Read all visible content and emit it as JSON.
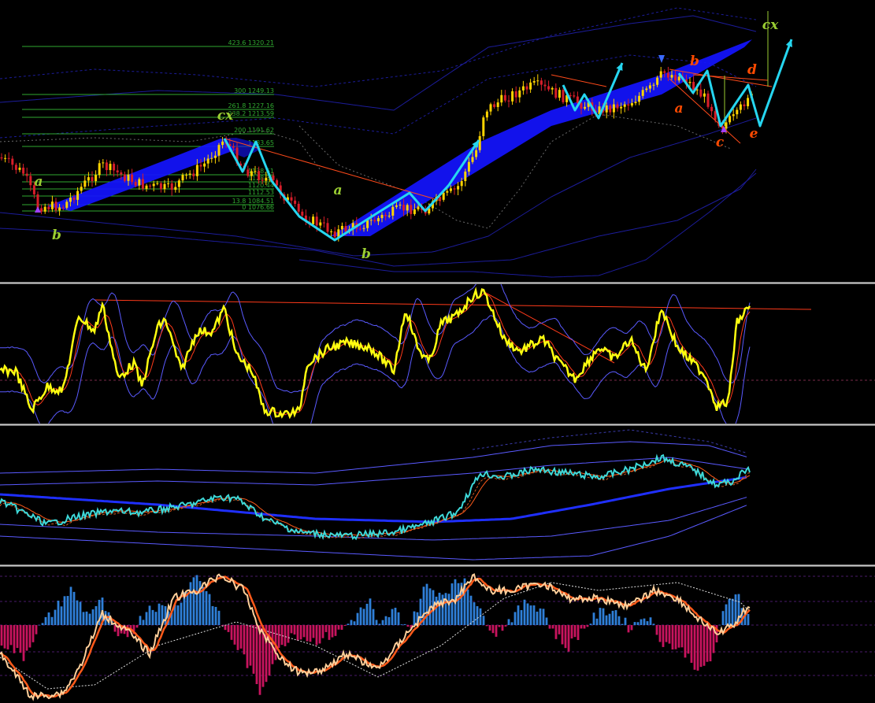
{
  "colors": {
    "background": "#000000",
    "candle": "#ffd400",
    "candle_down": "#d81e2a",
    "channel_fill": "#1414ff",
    "zigzag": "#26d6f0",
    "wave_green": "#9acd32",
    "wave_orange": "#ff4a00",
    "fib": "#2fa82f",
    "trend_red": "#ff4a1a",
    "band_navy": "#1c1c9a",
    "osc_yellow": "#ffff10",
    "osc_band": "#5a5aff",
    "osc_mid": "#ff3a1a",
    "line_cyan": "#3ed8d8",
    "line_blue": "#1f2fff",
    "hist_pos": "#2f7fd8",
    "hist_neg": "#c8145e",
    "peach": "#ffcf9a",
    "orange_line": "#ff5a1a",
    "dotted_white": "#e0e0e0"
  },
  "fib_levels": [
    {
      "label": "423.6 1320.21",
      "price": 1320.21
    },
    {
      "label": "300 1249.13",
      "price": 1249.13
    },
    {
      "label": "261.8 1227.16",
      "price": 1227.16
    },
    {
      "label": "238.2 1213.59",
      "price": 1213.59
    },
    {
      "label": "200 1191.62",
      "price": 1191.62
    },
    {
      "label": "1183.65",
      "price": 1183.65
    },
    {
      "label": "1138.61",
      "price": 1138.61
    },
    {
      "label": "1128.35",
      "price": 1128.35
    },
    {
      "label": "1120.44",
      "price": 1120.44
    },
    {
      "label": "1112.53",
      "price": 1112.53
    },
    {
      "label": "13.8 1084.51",
      "price": 1084.51
    },
    {
      "label": "0 1076.66",
      "price": 1076.66
    }
  ],
  "wave_labels": [
    {
      "text": "a",
      "color": "wave_green",
      "key": "a1"
    },
    {
      "text": "b",
      "color": "wave_green",
      "key": "b1"
    },
    {
      "text": "cx",
      "color": "wave_green",
      "key": "cx1"
    },
    {
      "text": "a",
      "color": "wave_green",
      "key": "a2"
    },
    {
      "text": "b",
      "color": "wave_green",
      "key": "b2"
    },
    {
      "text": "a",
      "color": "wave_orange",
      "key": "a3"
    },
    {
      "text": "b",
      "color": "wave_orange",
      "key": "b3"
    },
    {
      "text": "c",
      "color": "wave_orange",
      "key": "c3"
    },
    {
      "text": "d",
      "color": "wave_orange",
      "key": "d3"
    },
    {
      "text": "e",
      "color": "wave_orange",
      "key": "e3"
    },
    {
      "text": "cx",
      "color": "wave_green",
      "key": "cx2"
    }
  ],
  "chart_data": [
    {
      "type": "candlestick",
      "name": "price",
      "title": "",
      "grid": false,
      "annotations": [
        "Fibonacci extension levels",
        "Elliott wave labels",
        "zigzag projection arrows",
        "regression channel",
        "envelope bands"
      ]
    },
    {
      "type": "line",
      "name": "oscillator_1",
      "title": "",
      "grid": false,
      "series_colors": [
        "osc_yellow",
        "osc_band",
        "osc_mid"
      ]
    },
    {
      "type": "line",
      "name": "oscillator_2",
      "title": "",
      "grid": false,
      "series_colors": [
        "line_cyan",
        "line_blue",
        "orange_line"
      ]
    },
    {
      "type": "bar",
      "name": "histogram_oscillator",
      "title": "",
      "grid": false,
      "series_colors": [
        "hist_pos",
        "hist_neg",
        "peach",
        "orange_line",
        "dotted_white"
      ]
    }
  ]
}
